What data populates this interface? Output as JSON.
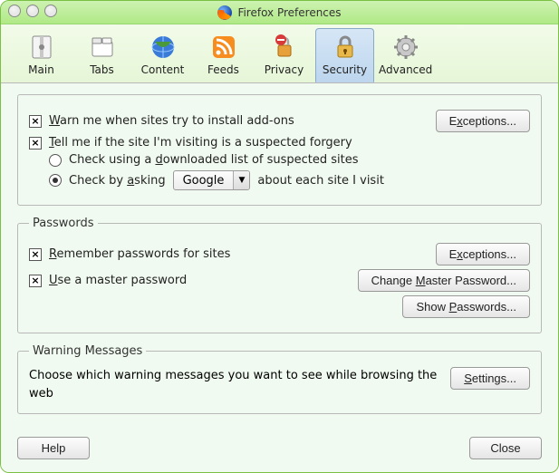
{
  "window": {
    "title": "Firefox Preferences"
  },
  "toolbar": {
    "items": [
      {
        "label": "Main"
      },
      {
        "label": "Tabs"
      },
      {
        "label": "Content"
      },
      {
        "label": "Feeds"
      },
      {
        "label": "Privacy"
      },
      {
        "label": "Security"
      },
      {
        "label": "Advanced"
      }
    ]
  },
  "sec1": {
    "warn_prefix": "W",
    "warn_rest": "arn me when sites try to install add-ons",
    "exceptions_pre": "E",
    "exceptions_u": "x",
    "exceptions_post": "ceptions...",
    "tell_prefix": "T",
    "tell_rest": "ell me if the site I'm visiting is a suspected forgery",
    "r1_pre": "Check using a ",
    "r1_u": "d",
    "r1_post": "ownloaded list of suspected sites",
    "r2_pre": "Check by ",
    "r2_u": "a",
    "r2_post": "sking",
    "provider": "Google",
    "r2_tail": "about each site I visit"
  },
  "passwords": {
    "legend": "Passwords",
    "remember_u": "R",
    "remember_rest": "emember passwords for sites",
    "master_u": "U",
    "master_rest": "se a master password",
    "btn_exc_pre": "E",
    "btn_exc_u": "x",
    "btn_exc_post": "ceptions...",
    "btn_change_pre": "Change ",
    "btn_change_u": "M",
    "btn_change_post": "aster Password...",
    "btn_show_pre": "Show ",
    "btn_show_u": "P",
    "btn_show_post": "asswords..."
  },
  "warnings": {
    "legend": "Warning Messages",
    "msg": "Choose which warning messages you want to see while browsing the web",
    "btn_pre": "",
    "btn_u": "S",
    "btn_post": "ettings..."
  },
  "footer": {
    "help": "Help",
    "close": "Close"
  },
  "checkmark": "×"
}
